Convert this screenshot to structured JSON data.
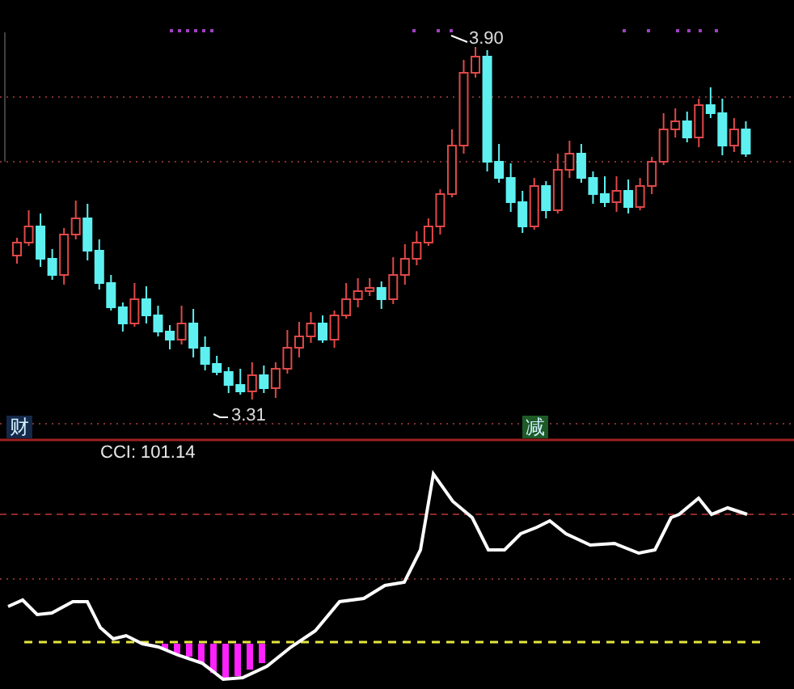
{
  "price_panel": {
    "high_label": "3.90",
    "low_label": "3.31",
    "markers": [
      {
        "text": "财",
        "color": "#14284a"
      },
      {
        "text": "减",
        "color": "#1d5a26"
      }
    ]
  },
  "indicator_panel": {
    "label": "CCI: 101.14"
  }
}
